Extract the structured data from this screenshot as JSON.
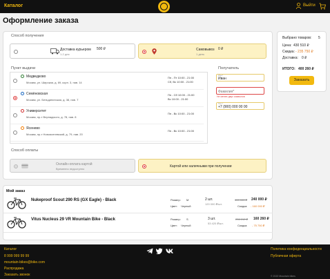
{
  "header": {
    "catalog": "Каталог",
    "exit": "Выйти"
  },
  "page_title": "Оформление заказа",
  "delivery": {
    "title": "Способ получения",
    "courier": {
      "label": "Доставка курьером",
      "price": "500 ₽",
      "days": "1-2 дня"
    },
    "pickup": {
      "label": "Самовывоз",
      "price": "0 ₽",
      "days": "1 день"
    }
  },
  "pickup_points": {
    "title": "Пункт выдачи",
    "items": [
      {
        "name": "Медведково",
        "address": "Москва, ул. Широкая, д. 69, корп. 3, пав. 14",
        "hours1": "Пн - Пт 10:00 - 21:00",
        "hours2": "Сб, Вс 10:00 - 21:00"
      },
      {
        "name": "Семёновская",
        "address": "Москва, ул. Бельдининская, д. 38, пав. Т",
        "hours1": "Пн - Сб 10:00 - 21:00",
        "hours2": "Вс 10:00 - 21:00"
      },
      {
        "name": "Университет",
        "address": "Москва, пр-т Вернадского, д. 78, пав. 8",
        "hours1": "Пн - Вс 10:00 - 21:00",
        "hours2": ""
      },
      {
        "name": "Ясенево",
        "address": "Москва, пр-т Новоясеневский, д. 79, пав. 20",
        "hours1": "Пн - Вс 10:00 - 21:00",
        "hours2": ""
      }
    ]
  },
  "recipient": {
    "title": "Получатель",
    "name_label": "Имя*",
    "name_value": "Иван",
    "surname_label": "Фамилия*",
    "surname_error": "Не менее двух символов",
    "phone_label": "Тел.*",
    "phone_value": "+7 (900) 000 00 00"
  },
  "payment": {
    "title": "Способ оплаты",
    "online": "Онлайн-оплата картой",
    "online_note": "Временно недоступно",
    "cash": "Картой или наличными при получении"
  },
  "summary": {
    "items_label": "Выбрано товаров:",
    "items_value": "5",
    "price_label": "Цена:",
    "price_value": "430 510 ₽",
    "discount_label": "Скидка:",
    "discount_value": "- 235 750 ₽",
    "delivery_label": "Доставка:",
    "delivery_value": "0 ₽",
    "total_label": "ИТОГО:",
    "total_value": "400 260 ₽",
    "order_button": "Заказать"
  },
  "my_order": {
    "title": "Мой заказ",
    "products": [
      {
        "name": "Nukeproof Scout 290 RS (GX Eagle) - Black",
        "size_label": "Размер:",
        "size": "M",
        "color_label": "Цвет:",
        "color": "Черный",
        "qty": "2 шт.",
        "unit": "120 000 ₽/шт.",
        "old_price": "400 000 ₽",
        "new_price": "240 000 ₽",
        "discount_label": "Скидка:",
        "discount": "- 160 000 ₽"
      },
      {
        "name": "Vitus Nucleus 29 VR Mountain Bike - Black",
        "size_label": "Размер:",
        "size": "S",
        "color_label": "Цвет:",
        "color": "Черный",
        "qty": "3 шт.",
        "unit": "53 420 ₽/шт.",
        "old_price": "236 010 ₽",
        "new_price": "160 260 ₽",
        "discount_label": "Скидка:",
        "discount": "- 75 750 ₽"
      }
    ]
  },
  "footer": {
    "left": [
      "Каталог",
      "8 999 999 99 99",
      "mountain-bikes@bike.com",
      "Распродажа",
      "Заказать звонок"
    ],
    "right": [
      "Политика конфиденциальности",
      "Публичная оферта"
    ],
    "copyright": "© 2022 Mountain bikes"
  },
  "colors": {
    "accent": "#f2b90f",
    "header_bg": "#111111",
    "error": "#dd4444",
    "selected_bg": "#fdf2c4"
  }
}
